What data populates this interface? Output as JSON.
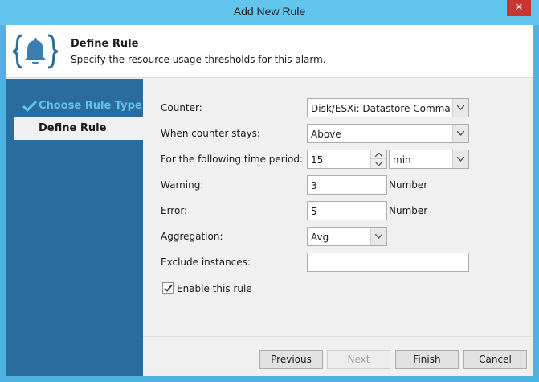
{
  "window": {
    "title": "Add New Rule",
    "close_label": "✕"
  },
  "header": {
    "icon": "bell-icon",
    "title": "Define Rule",
    "subtitle": "Specify the resource usage thresholds for this alarm."
  },
  "steps": [
    {
      "label": "Choose Rule Type",
      "state": "completed",
      "icon": "check-icon"
    },
    {
      "label": "Define Rule",
      "state": "current"
    }
  ],
  "form": {
    "counter": {
      "label": "Counter:",
      "value": "Disk/ESXi: Datastore Comma..."
    },
    "counter_stays": {
      "label": "When counter stays:",
      "value": "Above"
    },
    "time_period": {
      "label": "For the following time period:",
      "value": "15",
      "unit_value": "min"
    },
    "warning": {
      "label": "Warning:",
      "value": "3",
      "unit": "Number"
    },
    "error": {
      "label": "Error:",
      "value": "5",
      "unit": "Number"
    },
    "aggregation": {
      "label": "Aggregation:",
      "value": "Avg"
    },
    "exclude_instances": {
      "label": "Exclude instances:",
      "value": ""
    },
    "enable_rule": {
      "label": "Enable this rule",
      "checked": true
    }
  },
  "footer": {
    "previous": "Previous",
    "next": "Next",
    "finish": "Finish",
    "cancel": "Cancel"
  },
  "colors": {
    "titlebar": "#61c5ee",
    "frame": "#4fb3e2",
    "sidebar": "#2a6d9c",
    "completed_step": "#63c3ef",
    "close_button": "#c7372f"
  }
}
